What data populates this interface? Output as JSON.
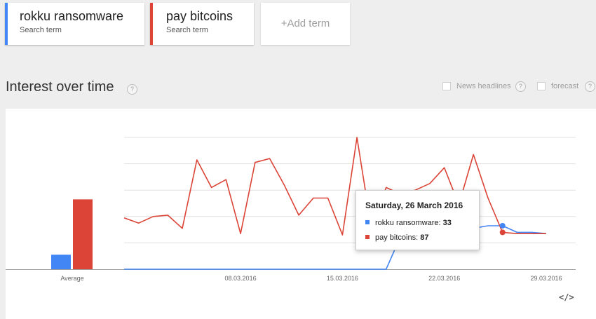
{
  "terms": [
    {
      "name": "rokku ransomware",
      "sub": "Search term",
      "color": "#4285f4"
    },
    {
      "name": "pay bitcoins",
      "sub": "Search term",
      "color": "#db4437"
    }
  ],
  "add_term_label": "+Add term",
  "section": {
    "title": "Interest over time",
    "news_headlines_label": "News headlines",
    "forecast_label": "forecast"
  },
  "tooltip": {
    "date": "Saturday, 26 March 2016",
    "rows": [
      {
        "label": "rokku ransomware:",
        "value": "33",
        "color": "#4285f4"
      },
      {
        "label": "pay bitcoins:",
        "value": "87",
        "color": "#db4437"
      }
    ]
  },
  "icons": {
    "help": "?",
    "embed": "</>"
  },
  "chart_data": {
    "type": "line",
    "ylim": [
      0,
      100
    ],
    "grid": true,
    "x_tick_labels": [
      "08.03.2016",
      "15.03.2016",
      "22.03.2016",
      "29.03.2016"
    ],
    "average_label": "Average",
    "averages": {
      "rokku ransomware": 11,
      "pay bitcoins": 53
    },
    "x": [
      "2016-02-29",
      "2016-03-01",
      "2016-03-02",
      "2016-03-03",
      "2016-03-04",
      "2016-03-05",
      "2016-03-06",
      "2016-03-07",
      "2016-03-08",
      "2016-03-09",
      "2016-03-10",
      "2016-03-11",
      "2016-03-12",
      "2016-03-13",
      "2016-03-14",
      "2016-03-15",
      "2016-03-16",
      "2016-03-17",
      "2016-03-18",
      "2016-03-19",
      "2016-03-20",
      "2016-03-21",
      "2016-03-22",
      "2016-03-23",
      "2016-03-24",
      "2016-03-25",
      "2016-03-26",
      "2016-03-27",
      "2016-03-28",
      "2016-03-29"
    ],
    "highlight_x": "2016-03-26",
    "series": [
      {
        "name": "rokku ransomware",
        "color": "#4285f4",
        "values": [
          0,
          0,
          0,
          0,
          0,
          0,
          0,
          0,
          0,
          0,
          0,
          0,
          0,
          0,
          0,
          0,
          0,
          0,
          0,
          25,
          22,
          27,
          27,
          27,
          31,
          33,
          33,
          28,
          28,
          27
        ]
      },
      {
        "name": "pay bitcoins",
        "color": "#db4437",
        "values": [
          39,
          35,
          40,
          41,
          31,
          83,
          62,
          68,
          27,
          81,
          84,
          64,
          41,
          54,
          54,
          26,
          100,
          30,
          62,
          57,
          60,
          65,
          77,
          49,
          87,
          54,
          28,
          27,
          27,
          27
        ]
      }
    ]
  }
}
